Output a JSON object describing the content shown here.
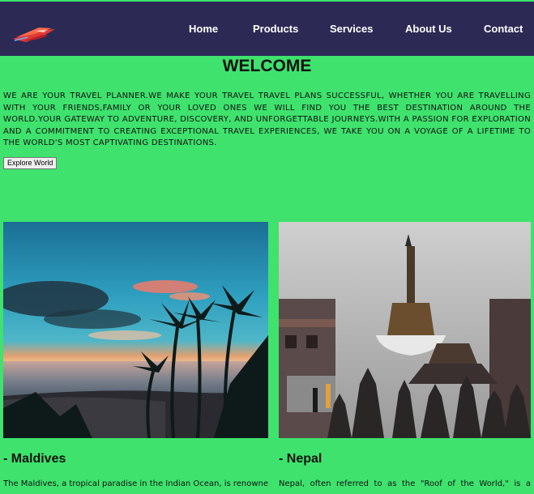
{
  "nav": {
    "links": [
      "Home",
      "Products",
      "Services",
      "About Us",
      "Contact"
    ]
  },
  "hero": {
    "title": "WELCOME",
    "intro": "WE ARE YOUR TRAVEL PLANNER.WE MAKE YOUR TRAVEL TRAVEL PLANS SUCCESSFUL, WHETHER YOU ARE TRAVELLING WITH YOUR FRIENDS,FAMILY OR YOUR LOVED ONES WE WILL FIND YOU THE BEST DESTINATION AROUND THE WORLD.YOUR GATEWAY TO ADVENTURE, DISCOVERY, AND UNFORGETTABLE JOURNEYS.WITH A PASSION FOR EXPLORATION AND A COMMITMENT TO CREATING EXCEPTIONAL TRAVEL EXPERIENCES, WE TAKE YOU ON A VOYAGE OF A LIFETIME TO THE WORLD'S MOST CAPTIVATING DESTINATIONS.",
    "button_label": "Explore World"
  },
  "destinations": [
    {
      "title": "- Maldives",
      "description": "The Maldives, a tropical paradise in the Indian Ocean, is renowned"
    },
    {
      "title": "- Nepal",
      "description": "Nepal, often referred to as the \"Roof of the World,\" is a"
    }
  ],
  "colors": {
    "page_background": "#3ee26d",
    "navbar_background": "#2c2a55",
    "nav_text": "#ffffff"
  },
  "icons": {
    "logo": "red-jet-logo"
  }
}
